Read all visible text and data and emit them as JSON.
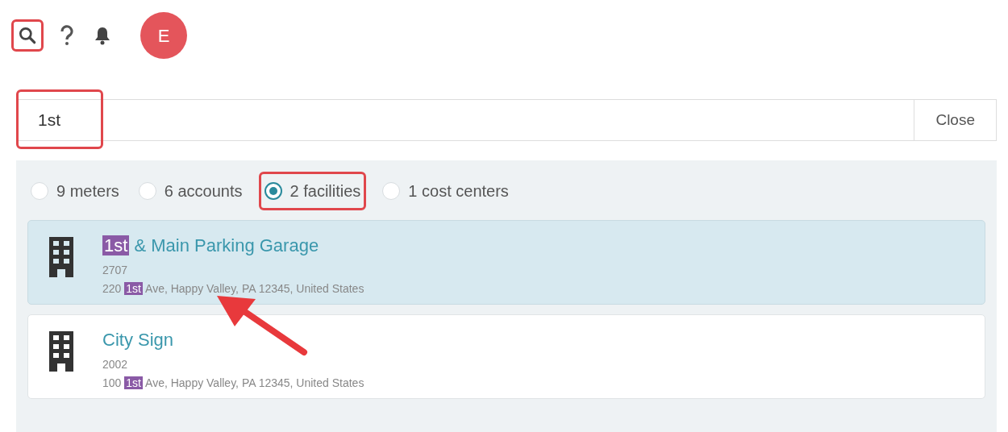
{
  "toolbar": {
    "search_callout": true,
    "avatar": "E"
  },
  "search": {
    "value": "1st",
    "callout": true,
    "close": "Close"
  },
  "filters": [
    {
      "label": "9 meters",
      "selected": false,
      "callout": false
    },
    {
      "label": "6 accounts",
      "selected": false,
      "callout": false
    },
    {
      "label": "2 facilities",
      "selected": true,
      "callout": true
    },
    {
      "label": "1 cost centers",
      "selected": false,
      "callout": false
    }
  ],
  "results": [
    {
      "selected": true,
      "title": [
        {
          "text": "1st",
          "match": true
        },
        {
          "text": " & Main Parking Garage",
          "match": false
        }
      ],
      "code": "2707",
      "address": [
        {
          "text": "220 ",
          "match": false
        },
        {
          "text": "1st",
          "match": true
        },
        {
          "text": " Ave, Happy Valley, PA 12345, United States",
          "match": false
        }
      ]
    },
    {
      "selected": false,
      "title": [
        {
          "text": "City Sign",
          "match": false
        }
      ],
      "code": "2002",
      "address": [
        {
          "text": "100 ",
          "match": false
        },
        {
          "text": "1st",
          "match": true
        },
        {
          "text": " Ave, Happy Valley, PA 12345, United States",
          "match": false
        }
      ]
    }
  ],
  "pointer_arrow": true
}
